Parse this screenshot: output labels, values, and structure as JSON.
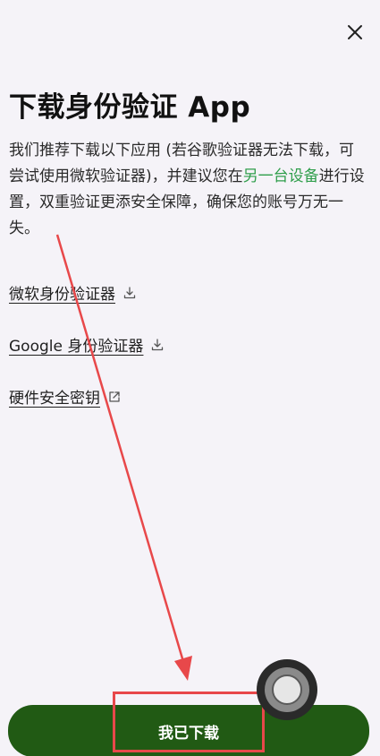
{
  "header": {
    "close_icon": "close-icon",
    "title": "下载身份验证 App"
  },
  "description": {
    "part1": "我们推荐下载以下应用 (若谷歌验证器无法下载，可尝试使用微软验证器)，并建议您在",
    "highlight": "另一台设备",
    "part2": "进行设置，双重验证更添安全保障，确保您的账号万无一失。",
    "highlight_color": "#2f9e4b"
  },
  "links": [
    {
      "label": "微软身份验证器",
      "icon": "download-icon"
    },
    {
      "label": "Google 身份验证器",
      "icon": "download-icon"
    },
    {
      "label": "硬件安全密钥",
      "icon": "external-link-icon"
    }
  ],
  "primary_button": {
    "label": "我已下载",
    "color": "#215a14"
  },
  "annotations": {
    "color": "#e8484a"
  }
}
